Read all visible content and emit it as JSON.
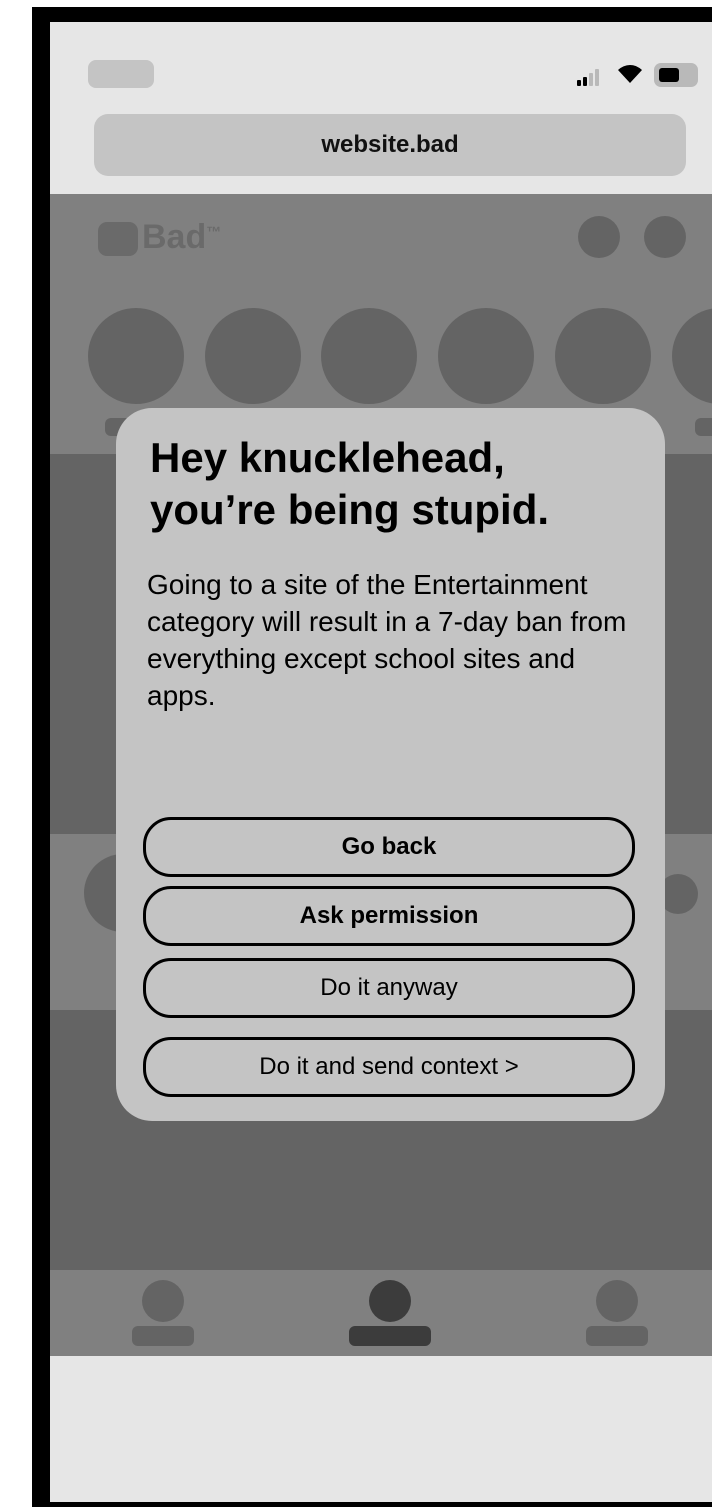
{
  "status_bar": {
    "signal_icon": "cellular-signal-icon",
    "wifi_icon": "wifi-icon",
    "battery_icon": "battery-icon"
  },
  "browser": {
    "url": "website.bad"
  },
  "site": {
    "logo_text": "Bad",
    "logo_trademark": "™"
  },
  "dialog": {
    "title": "Hey knucklehead,\nyou’re being stupid.",
    "body": "Going to a site of the Entertainment category will result in a 7-day ban from everything except school sites and apps.",
    "buttons": {
      "go_back": "Go back",
      "ask_permission": "Ask permission",
      "do_it_anyway": "Do it anyway",
      "do_it_send_context": "Do it and send context >"
    }
  },
  "colors": {
    "frame": "#000000",
    "screen_bg": "#e6e6e6",
    "chrome_gray": "#c4c4c4",
    "page_gray": "#808080",
    "placeholder_dark": "#646464",
    "active_tab": "#3c3c3c"
  }
}
